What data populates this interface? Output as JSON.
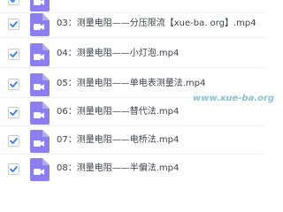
{
  "files": [
    {
      "name": "",
      "checked": true
    },
    {
      "name": "03：测量电阻——分压限流【xue-ba. org】.mp4",
      "checked": true
    },
    {
      "name": "04：测量电阻——小灯泡.mp4",
      "checked": true
    },
    {
      "name": "05：测量电阻——单电表测量法.mp4",
      "checked": true
    },
    {
      "name": "06：测量电阻——替代法.mp4",
      "checked": true
    },
    {
      "name": "07：测量电阻——电桥法.mp4",
      "checked": true
    },
    {
      "name": "08：测量电阻——半偏法.mp4",
      "checked": true
    }
  ],
  "watermark": "www.xue-ba.org",
  "colors": {
    "icon": "#8b7ef0",
    "check": "#2f7ff0"
  },
  "icons": {
    "file": "video-file-icon",
    "check": "checkmark-icon"
  }
}
